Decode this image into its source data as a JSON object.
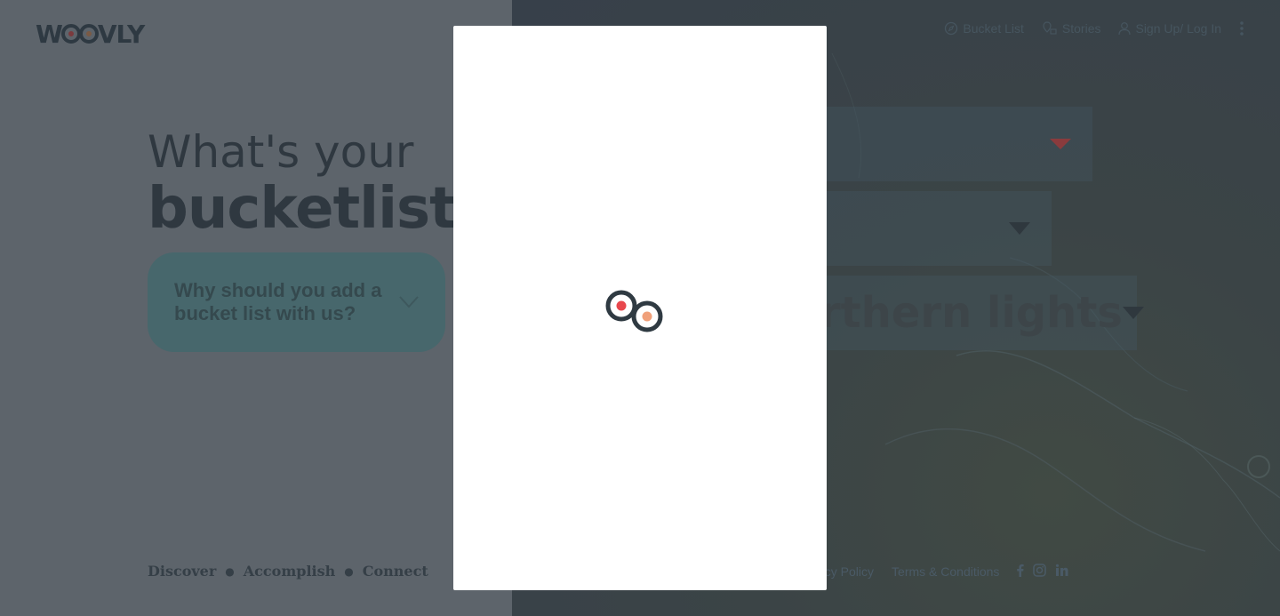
{
  "brand": {
    "logo_text": [
      "W",
      "VLY"
    ]
  },
  "nav": {
    "items": [
      {
        "label": "Bucket List",
        "icon": "compass-icon"
      },
      {
        "label": "Stories",
        "icon": "pin-icon"
      },
      {
        "label": "Sign Up/ Log In",
        "icon": "user-icon"
      }
    ],
    "more_icon": "kebab-menu-icon"
  },
  "hero": {
    "line1": "What's your",
    "line2": "bucketlist?",
    "why_card": "Why should you add a bucket list with us?"
  },
  "selectors": {
    "third_value": "rthern lights"
  },
  "footer": {
    "tagline": [
      "Discover",
      "Accomplish",
      "Connect"
    ],
    "links": [
      "acy Policy",
      "Terms & Conditions"
    ],
    "social": [
      "facebook-icon",
      "instagram-icon",
      "linkedin-icon"
    ]
  },
  "modal": {
    "state": "loading",
    "loader_icon": "woovly-loader-icon"
  },
  "colors": {
    "overlay": "#5d646b",
    "loader_ring": "#2f3a42",
    "loader_red": "#e8474d",
    "loader_orange": "#f0a07a"
  }
}
